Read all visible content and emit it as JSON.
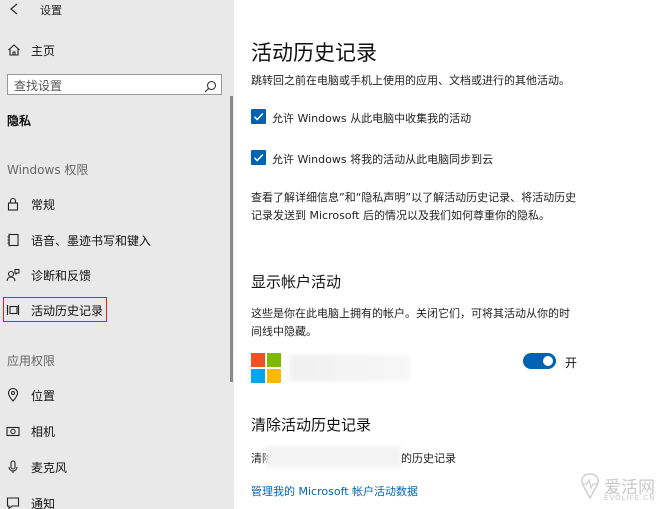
{
  "window": {
    "title": "设置"
  },
  "sidebar": {
    "home_label": "主页",
    "search_placeholder": "查找设置",
    "section_title": "隐私",
    "group_windows": "Windows 权限",
    "items": [
      {
        "label": "常规",
        "icon": "lock-icon"
      },
      {
        "label": "语音、墨迹书写和键入",
        "icon": "notebook-icon"
      },
      {
        "label": "诊断和反馈",
        "icon": "person-feedback-icon"
      },
      {
        "label": "活动历史记录",
        "icon": "timeline-icon"
      }
    ],
    "group_app": "应用权限",
    "app_items": [
      {
        "label": "位置",
        "icon": "location-icon"
      },
      {
        "label": "相机",
        "icon": "camera-icon"
      },
      {
        "label": "麦克风",
        "icon": "microphone-icon"
      },
      {
        "label": "通知",
        "icon": "chat-icon"
      }
    ]
  },
  "main": {
    "title": "活动历史记录",
    "description": "跳转回之前在电脑或手机上使用的应用、文档或进行的其他活动。",
    "checkbox1": {
      "label": "允许 Windows 从此电脑中收集我的活动",
      "checked": true
    },
    "checkbox2": {
      "label": "允许 Windows 将我的活动从此电脑同步到云",
      "checked": true
    },
    "info_line1": "查看了解详细信息”和“隐私声明”以了解活动历史记录、将活动历史",
    "info_line2": "记录发送到 Microsoft 后的情况以及我们如何尊重你的隐私。",
    "accounts_title": "显示帐户活动",
    "accounts_desc_line1": "这些是你在此电脑上拥有的帐户。关闭它们，可将其活动从你的时",
    "accounts_desc_line2": "间线中隐藏。",
    "account_toggle": {
      "state_label": "开",
      "on": true
    },
    "clear_title": "清除活动历史记录",
    "clear_text_prefix": "清除",
    "clear_text_suffix": "的历史记录",
    "manage_link": "管理我的 Microsoft 帐户活动数据"
  },
  "colors": {
    "accent": "#0063b1",
    "link": "#0066b4",
    "highlight_box": "#e0201b",
    "sidebar_bg": "#e9e9e9"
  },
  "watermark": {
    "text": "爱活网",
    "sub": "EVOLIFE.CN"
  }
}
